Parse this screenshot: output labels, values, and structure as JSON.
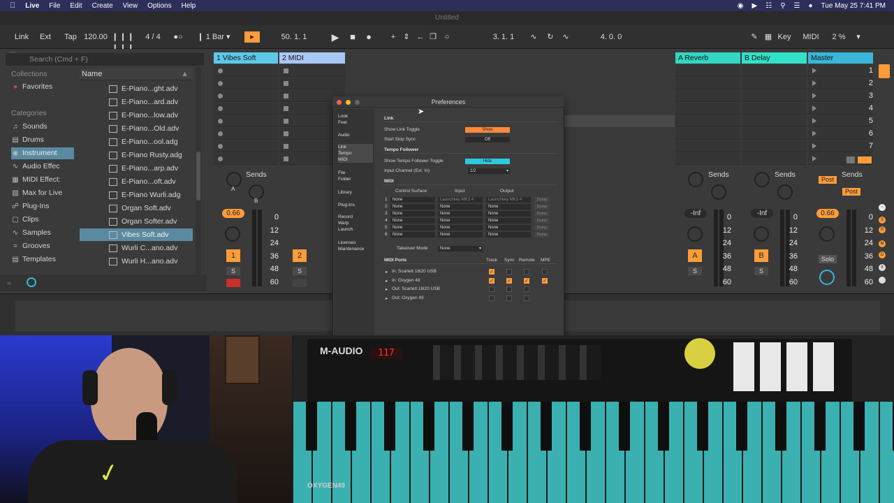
{
  "menubar": {
    "app": "Live",
    "items": [
      "File",
      "Edit",
      "Create",
      "View",
      "Options",
      "Help"
    ],
    "clock": "Tue May 25  7:41 PM"
  },
  "window_title": "Untitled",
  "transport": {
    "link": "Link",
    "ext": "Ext",
    "tap": "Tap",
    "tempo": "120.00",
    "signature": "4 / 4",
    "quantize": "1 Bar",
    "position": "50.  1.  1",
    "loop_start": "3.  1.  1",
    "loop_length": "4.  0.  0",
    "key": "Key",
    "midi": "MIDI",
    "cpu": "2 %"
  },
  "browser": {
    "search_placeholder": "Search (Cmd + F)",
    "collections_header": "Collections",
    "favorites": "Favorites",
    "categories_header": "Categories",
    "categories": [
      "Sounds",
      "Drums",
      "Instrument",
      "Audio Effec",
      "MIDI Effect:",
      "Max for Live",
      "Plug-Ins",
      "Clips",
      "Samples",
      "Grooves",
      "Templates"
    ],
    "selected_category": "Instrument",
    "name_header": "Name",
    "files": [
      "E-Piano...ght.adv",
      "E-Piano...ard.adv",
      "E-Piano...low.adv",
      "E-Piano...Old.adv",
      "E-Piano...ool.adg",
      "E-Piano Rusty.adg",
      "E-Piano...arp.adv",
      "E-Piano...oft.adv",
      "E-Piano Wurli.adg",
      "Organ Soft.adv",
      "Organ Softer.adv",
      "Vibes Soft.adv",
      "Wurli C...ano.adv",
      "Wurli H...ano.adv"
    ],
    "selected_file": "Vibes Soft.adv"
  },
  "session": {
    "tracks": [
      {
        "name": "1 Vibes Soft",
        "color": "#5ec8e8"
      },
      {
        "name": "2 MIDI",
        "color": "#a9c8f5"
      },
      {
        "name": "A Reverb",
        "color": "#33d6c2"
      },
      {
        "name": "B Delay",
        "color": "#33e0c8"
      },
      {
        "name": "Master",
        "color": "#39b6d8"
      }
    ],
    "scenes": [
      "1",
      "2",
      "3",
      "4",
      "5",
      "6",
      "7"
    ],
    "sends_label": "Sends",
    "track1_volume": "0.66",
    "master_volume": "0.66",
    "return_volume": "-Inf",
    "track1_num": "1",
    "track2_num": "2",
    "return_a": "A",
    "return_b": "B",
    "solo": "S",
    "post": "Post",
    "master_solo": "Solo",
    "db_scale": [
      "0",
      "12",
      "24",
      "36",
      "48",
      "60"
    ]
  },
  "prefs": {
    "title": "Preferences",
    "tabs": [
      "Look\nFeel",
      "Audio",
      "Link\nTempo\nMIDI",
      "File\nFolder",
      "Library",
      "Plug-Ins",
      "Record\nWarp\nLaunch",
      "Licenses\nMaintenance"
    ],
    "link_header": "Link",
    "show_link_toggle": "Show Link Toggle",
    "show_link_value": "Show",
    "start_stop_sync": "Start Stop Sync",
    "start_stop_value": "Off",
    "tempo_follower_header": "Tempo Follower",
    "show_tempo_follower": "Show Tempo Follower Toggle",
    "show_tempo_value": "Hide",
    "input_channel": "Input Channel (Ext. In)",
    "input_channel_value": "1/2",
    "midi_header": "MIDI",
    "col_control_surface": "Control Surface",
    "col_input": "Input",
    "col_output": "Output",
    "surfaces": [
      {
        "n": "1",
        "cs": "None",
        "in": "Launchkey MK3 4",
        "out": "Launchkey MK3 4",
        "dump": "Dump"
      },
      {
        "n": "2",
        "cs": "None",
        "in": "None",
        "out": "None",
        "dump": "Dump"
      },
      {
        "n": "3",
        "cs": "None",
        "in": "None",
        "out": "None",
        "dump": "Dump"
      },
      {
        "n": "4",
        "cs": "None",
        "in": "None",
        "out": "None",
        "dump": "Dump"
      },
      {
        "n": "5",
        "cs": "None",
        "in": "None",
        "out": "None",
        "dump": "Dump"
      },
      {
        "n": "6",
        "cs": "None",
        "in": "None",
        "out": "None",
        "dump": "Dump"
      }
    ],
    "takeover_label": "Takeover Mode",
    "takeover_value": "None",
    "midi_ports_header": "MIDI Ports",
    "port_cols": [
      "Track",
      "Sync",
      "Remote",
      "MPE"
    ],
    "ports": [
      {
        "name": "In:  Scarlett 18i20 USB",
        "checks": [
          true,
          false,
          false,
          false
        ]
      },
      {
        "name": "In:  Oxygen 49",
        "checks": [
          true,
          true,
          true,
          true
        ]
      },
      {
        "name": "Out: Scarlett 18i20 USB",
        "checks": [
          false,
          false,
          false,
          false
        ]
      },
      {
        "name": "Out: Oxygen 49",
        "checks": [
          false,
          false,
          false,
          false
        ]
      }
    ]
  },
  "camera": {
    "brand": "M-AUDIO",
    "model": "OXYGEN49",
    "display": "117"
  },
  "colors": {
    "accent": "#ff9c3a",
    "selection": "#5a8aa0",
    "link_show": "#ff8a3a",
    "tempo_hide": "#2fc8e0"
  }
}
